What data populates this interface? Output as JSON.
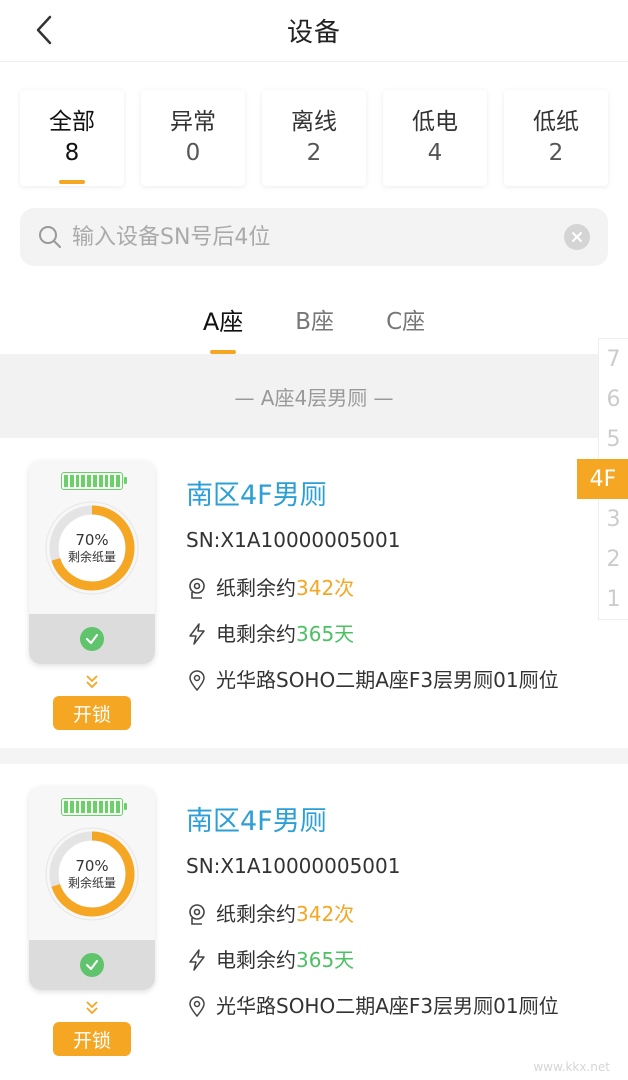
{
  "header": {
    "title": "设备"
  },
  "filters": [
    {
      "label": "全部",
      "count": "8",
      "active": true
    },
    {
      "label": "异常",
      "count": "0",
      "active": false
    },
    {
      "label": "离线",
      "count": "2",
      "active": false
    },
    {
      "label": "低电",
      "count": "4",
      "active": false
    },
    {
      "label": "低纸",
      "count": "2",
      "active": false
    }
  ],
  "search": {
    "placeholder": "输入设备SN号后4位"
  },
  "tabs": [
    {
      "label": "A座",
      "active": true
    },
    {
      "label": "B座",
      "active": false
    },
    {
      "label": "C座",
      "active": false
    }
  ],
  "section": {
    "title": "— A座4层男厕 —"
  },
  "floors": [
    "7",
    "6",
    "5",
    "4F",
    "3",
    "2",
    "1"
  ],
  "active_floor": "4F",
  "devices": [
    {
      "name": "南区4F男厕",
      "sn": "SN:X1A10000005001",
      "paper_pct": "70%",
      "paper_fraction": 0.7,
      "paper_label": "剩余纸量",
      "paper_prefix": "纸剩余约",
      "paper_value": "342次",
      "power_prefix": "电剩余约",
      "power_value": "365天",
      "location": "光华路SOHO二期A座F3层男厕01厕位",
      "unlock_label": "开锁"
    },
    {
      "name": "南区4F男厕",
      "sn": "SN:X1A10000005001",
      "paper_pct": "70%",
      "paper_fraction": 0.7,
      "paper_label": "剩余纸量",
      "paper_prefix": "纸剩余约",
      "paper_value": "342次",
      "power_prefix": "电剩余约",
      "power_value": "365天",
      "location": "光华路SOHO二期A座F3层男厕01厕位",
      "unlock_label": "开锁"
    }
  ],
  "watermark": {
    "text": "www.kkx.net"
  },
  "colors": {
    "accent": "#f5a623",
    "name": "#2b9fd6",
    "green": "#4cc163"
  }
}
